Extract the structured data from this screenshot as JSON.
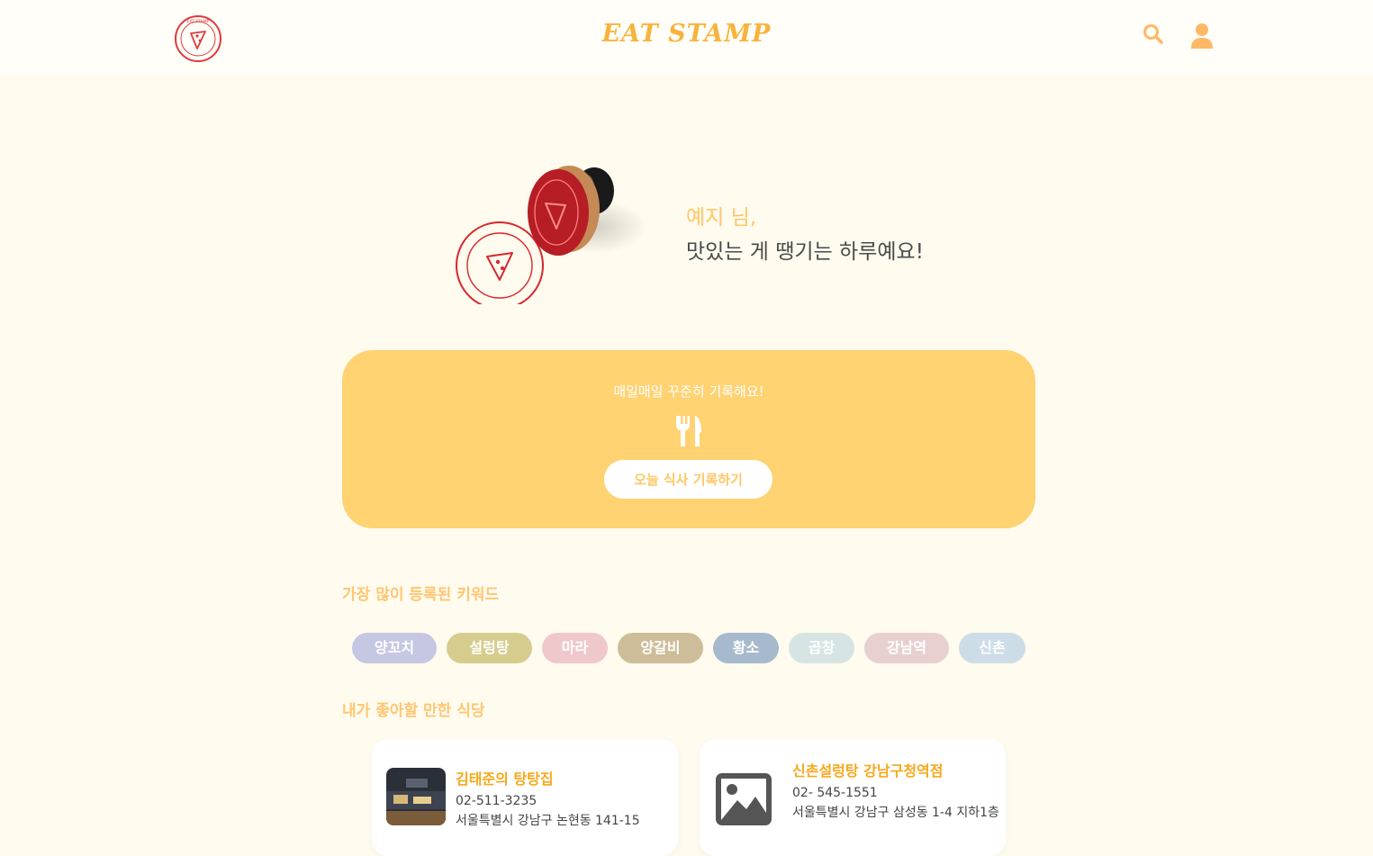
{
  "header": {
    "brand": "EAT STAMP",
    "logo_text": "EAT STAMP",
    "icons": {
      "search": "search-icon",
      "user": "user-icon"
    },
    "accent_color": "#f8b33c"
  },
  "hero": {
    "image": "stamp-illustration",
    "greeting_name": "예지 님,",
    "greeting_message": "맛있는 게 땡기는 하루예요!"
  },
  "banner": {
    "text": "매일매일 꾸준히 기록해요!",
    "icon": "fork-knife-icon",
    "button_label": "오늘 식사 기록하기",
    "color": "#ffd272"
  },
  "keywords": {
    "title": "가장 많이 등록된 키워드",
    "items": [
      {
        "label": "양꼬치",
        "color": "#c5c7e3"
      },
      {
        "label": "설렁탕",
        "color": "#d5cc8e"
      },
      {
        "label": "마라",
        "color": "#efc8cb"
      },
      {
        "label": "양갈비",
        "color": "#cdbd98"
      },
      {
        "label": "황소",
        "color": "#a7b9cd"
      },
      {
        "label": "곱창",
        "color": "#d6e5e3"
      },
      {
        "label": "강남역",
        "color": "#e8d0d1"
      },
      {
        "label": "신촌",
        "color": "#cddde8"
      }
    ]
  },
  "recommendations": {
    "title": "내가 좋아할 만한 식당",
    "items": [
      {
        "name": "김태준의 탕탕집",
        "phone": "02-511-3235",
        "address": "서울특별시 강남구 논현동 141-15",
        "image": "restaurant-photo"
      },
      {
        "name": "신촌설렁탕 강남구청역점",
        "phone": "02- 545-1551",
        "address": "서울특별시 강남구 삼성동 1-4 지하1층",
        "image": "image-placeholder-icon"
      }
    ]
  }
}
